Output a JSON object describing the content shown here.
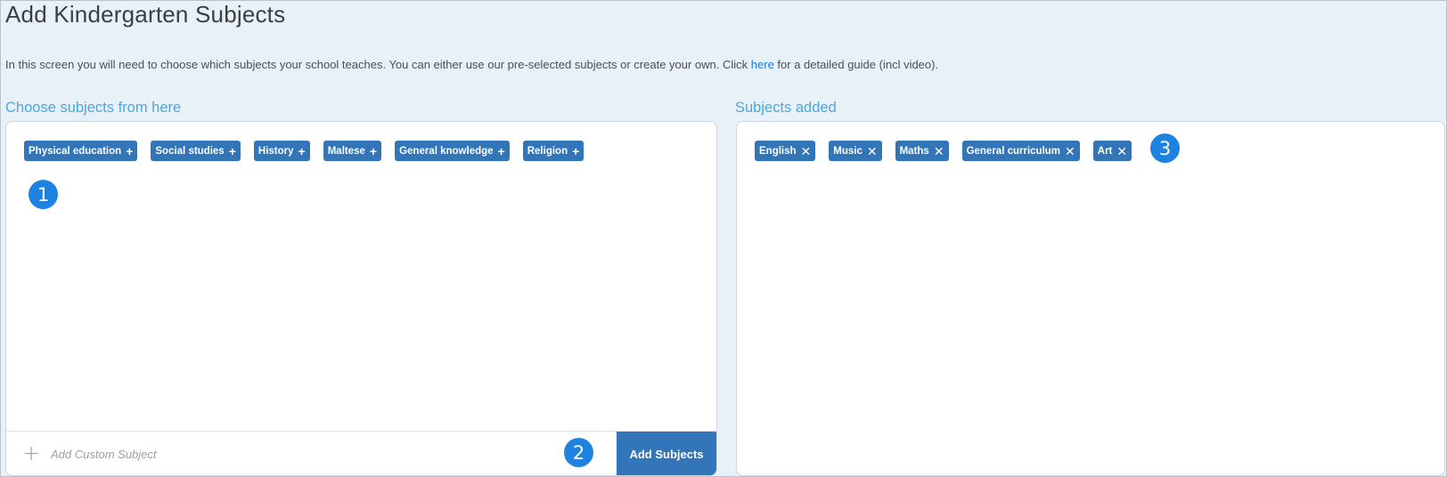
{
  "page": {
    "title": "Add Kindergarten Subjects",
    "intro_before_link": "In this screen you will need to choose which subjects your school teaches. You can either use our pre-selected subjects or create your own. Click ",
    "intro_link": "here",
    "intro_after_link": " for a detailed guide (incl video)."
  },
  "available": {
    "heading": "Choose subjects from here",
    "tags": [
      {
        "label": "Physical education",
        "icon": "plus-icon"
      },
      {
        "label": "Social studies",
        "icon": "plus-icon"
      },
      {
        "label": "History",
        "icon": "plus-icon"
      },
      {
        "label": "Maltese",
        "icon": "plus-icon"
      },
      {
        "label": "General knowledge",
        "icon": "plus-icon"
      },
      {
        "label": "Religion",
        "icon": "plus-icon"
      }
    ],
    "custom_placeholder": "Add Custom Subject",
    "add_button": "Add Subjects"
  },
  "added": {
    "heading": "Subjects added",
    "tags": [
      {
        "label": "English",
        "icon": "close-icon"
      },
      {
        "label": "Music",
        "icon": "close-icon"
      },
      {
        "label": "Maths",
        "icon": "close-icon"
      },
      {
        "label": "General curriculum",
        "icon": "close-icon"
      },
      {
        "label": "Art",
        "icon": "close-icon"
      }
    ]
  },
  "badges": [
    "1",
    "2",
    "3"
  ],
  "colors": {
    "accent": "#3275b8",
    "heading": "#4aa8e0",
    "badge": "#1e83e0",
    "link": "#1a7cdc",
    "background": "#e8f0f8"
  }
}
